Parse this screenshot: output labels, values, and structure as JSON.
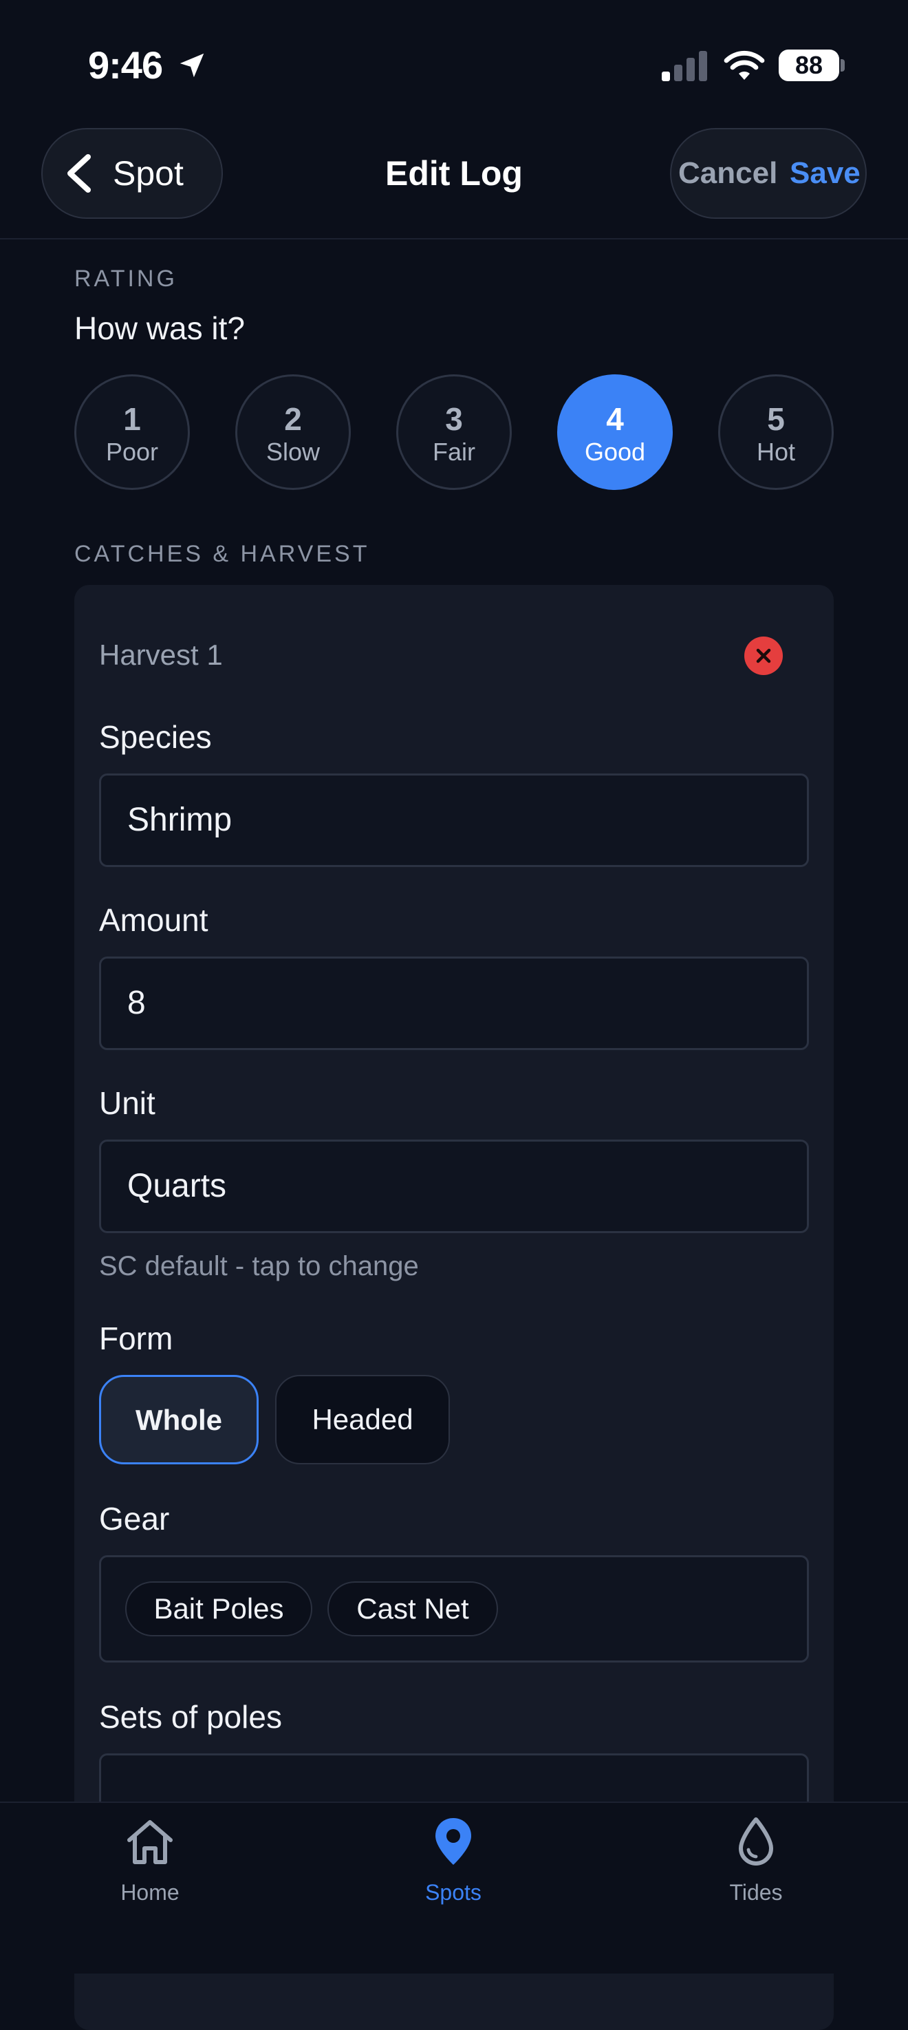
{
  "status_bar": {
    "time": "9:46",
    "battery": "88",
    "icons": [
      "location-arrow-icon",
      "cellular-signal-icon",
      "wifi-icon",
      "battery-icon"
    ]
  },
  "nav": {
    "back_label": "Spot",
    "title": "Edit Log",
    "cancel_label": "Cancel",
    "save_label": "Save"
  },
  "rating": {
    "section_label": "RATING",
    "question": "How was it?",
    "selected": 4,
    "options": [
      {
        "number": "1",
        "word": "Poor"
      },
      {
        "number": "2",
        "word": "Slow"
      },
      {
        "number": "3",
        "word": "Fair"
      },
      {
        "number": "4",
        "word": "Good"
      },
      {
        "number": "5",
        "word": "Hot"
      }
    ]
  },
  "catches": {
    "section_label": "CATCHES & HARVEST",
    "harvest": {
      "title": "Harvest 1",
      "species_label": "Species",
      "species_value": "Shrimp",
      "amount_label": "Amount",
      "amount_value": "8",
      "unit_label": "Unit",
      "unit_value": "Quarts",
      "unit_hint": "SC default - tap to change",
      "form_label": "Form",
      "form_options": [
        "Whole",
        "Headed"
      ],
      "form_selected": "Whole",
      "gear_label": "Gear",
      "gear_chips": [
        "Bait Poles",
        "Cast Net"
      ],
      "sets_label": "Sets of poles",
      "sets_value": ""
    }
  },
  "tabbar": {
    "items": [
      {
        "label": "Home",
        "icon": "home-icon"
      },
      {
        "label": "Spots",
        "icon": "map-pin-icon"
      },
      {
        "label": "Tides",
        "icon": "water-drop-icon"
      }
    ],
    "active": "Spots"
  },
  "colors": {
    "background": "#0b0f1a",
    "card": "#151a27",
    "accent": "#3b82f6",
    "save": "#4a8ef5",
    "danger": "#e53e3e",
    "muted": "#8d95a5"
  }
}
